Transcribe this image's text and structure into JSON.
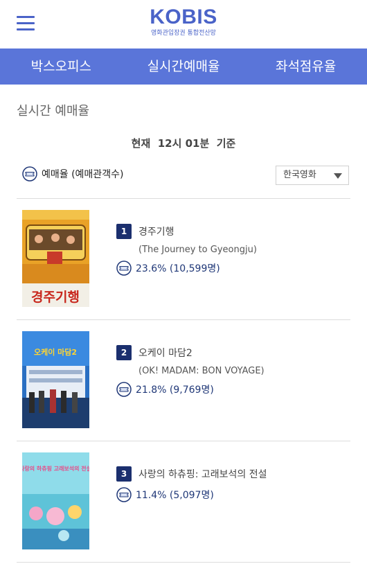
{
  "header": {
    "logo_title": "KOBIS",
    "logo_subtitle": "영화관입장권 통합전산망",
    "menu_icon": "hamburger-menu-icon"
  },
  "nav": {
    "tabs": [
      "박스오피스",
      "실시간예매율",
      "좌석점유율"
    ]
  },
  "page": {
    "section_title": "실시간 예매율",
    "time_reference": "현재  12시 01분  기준"
  },
  "legend": {
    "label": "예매율 (예매관객수)",
    "icon": "ticket-icon"
  },
  "filter": {
    "selected": "한국영화"
  },
  "colors": {
    "brand": "#4a63c8",
    "nav_bg": "#5a75d9",
    "rank_badge": "#1b2f6e",
    "rate_text": "#1f3777"
  },
  "movies": [
    {
      "rank": "1",
      "title": "경주기행",
      "subtitle": "(The Journey to Gyeongju)",
      "rate": "23.6% (10,599명)",
      "poster_text": "경주기행"
    },
    {
      "rank": "2",
      "title": "오케이 마담2",
      "subtitle": "(OK! MADAM: BON VOYAGE)",
      "rate": "21.8% (9,769명)",
      "poster_text": "오케이 마담2"
    },
    {
      "rank": "3",
      "title": "사랑의 하츄핑: 고래보석의 전설",
      "subtitle": "",
      "rate": "11.4% (5,097명)",
      "poster_text": "사랑의 하츄핑 고래보석의 전설"
    }
  ]
}
